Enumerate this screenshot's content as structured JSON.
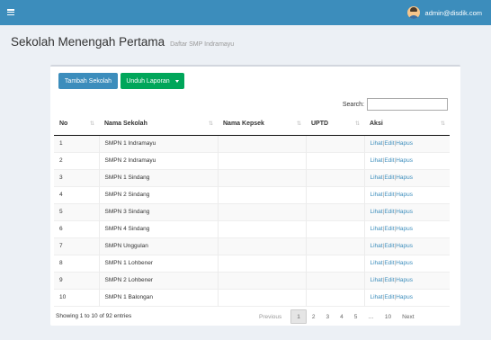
{
  "topbar": {
    "user_email": "admin@disdik.com"
  },
  "header": {
    "title": "Sekolah Menengah Pertama",
    "subtitle": "Daftar SMP Indramayu"
  },
  "toolbar": {
    "add_label": "Tambah Sekolah",
    "download_label": "Unduh Laporan"
  },
  "search": {
    "label": "Search:",
    "value": ""
  },
  "table": {
    "columns": [
      "No",
      "Nama Sekolah",
      "Nama Kepsek",
      "UPTD",
      "Aksi"
    ],
    "rows": [
      {
        "no": "1",
        "nama": "SMPN 1 Indramayu",
        "kepsek": "",
        "uptd": ""
      },
      {
        "no": "2",
        "nama": "SMPN 2 Indramayu",
        "kepsek": "",
        "uptd": ""
      },
      {
        "no": "3",
        "nama": "SMPN 1 Sindang",
        "kepsek": "",
        "uptd": ""
      },
      {
        "no": "4",
        "nama": "SMPN 2 Sindang",
        "kepsek": "",
        "uptd": ""
      },
      {
        "no": "5",
        "nama": "SMPN 3 Sindang",
        "kepsek": "",
        "uptd": ""
      },
      {
        "no": "6",
        "nama": "SMPN 4 Sindang",
        "kepsek": "",
        "uptd": ""
      },
      {
        "no": "7",
        "nama": "SMPN Unggulan",
        "kepsek": "",
        "uptd": ""
      },
      {
        "no": "8",
        "nama": "SMPN 1 Lohbener",
        "kepsek": "",
        "uptd": ""
      },
      {
        "no": "9",
        "nama": "SMPN 2 Lohbener",
        "kepsek": "",
        "uptd": ""
      },
      {
        "no": "10",
        "nama": "SMPN 1 Balongan",
        "kepsek": "",
        "uptd": ""
      }
    ],
    "actions": {
      "view": "Lihat",
      "edit": "Edit",
      "delete": "Hapus",
      "separator": "|"
    }
  },
  "footer": {
    "info": "Showing 1 to 10 of 92 entries",
    "pagination": {
      "previous": "Previous",
      "pages": [
        "1",
        "2",
        "3",
        "4",
        "5",
        "…",
        "10"
      ],
      "next": "Next",
      "current": "1"
    }
  },
  "colors": {
    "primary": "#3c8dbc",
    "success": "#00a65a",
    "background": "#ecf0f5"
  }
}
